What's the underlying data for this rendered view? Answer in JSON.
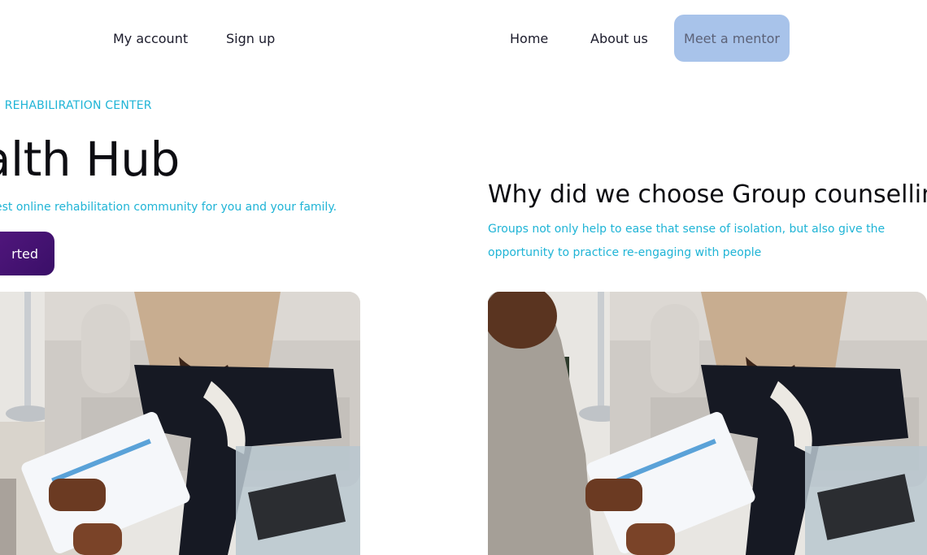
{
  "nav": {
    "my_account": "My account",
    "sign_up": "Sign up",
    "home": "Home",
    "about_us": "About us",
    "meet_mentor": "Meet a mentor"
  },
  "hero": {
    "eyebrow": "E REHABILIRATION CENTER",
    "title": "alth Hub",
    "subtitle": "est online rehabilitation community for you and your family.",
    "cta_label": "rted"
  },
  "section": {
    "title": "Why did we choose Group counselling",
    "body": "Groups not only help to ease that sense of isolation, but also give the opportunity to practice re-engaging with people"
  },
  "colors": {
    "accent_cyan": "#1fb4d6",
    "cta_purple": "#4a1478",
    "mentor_button": "#a8c3ea"
  }
}
